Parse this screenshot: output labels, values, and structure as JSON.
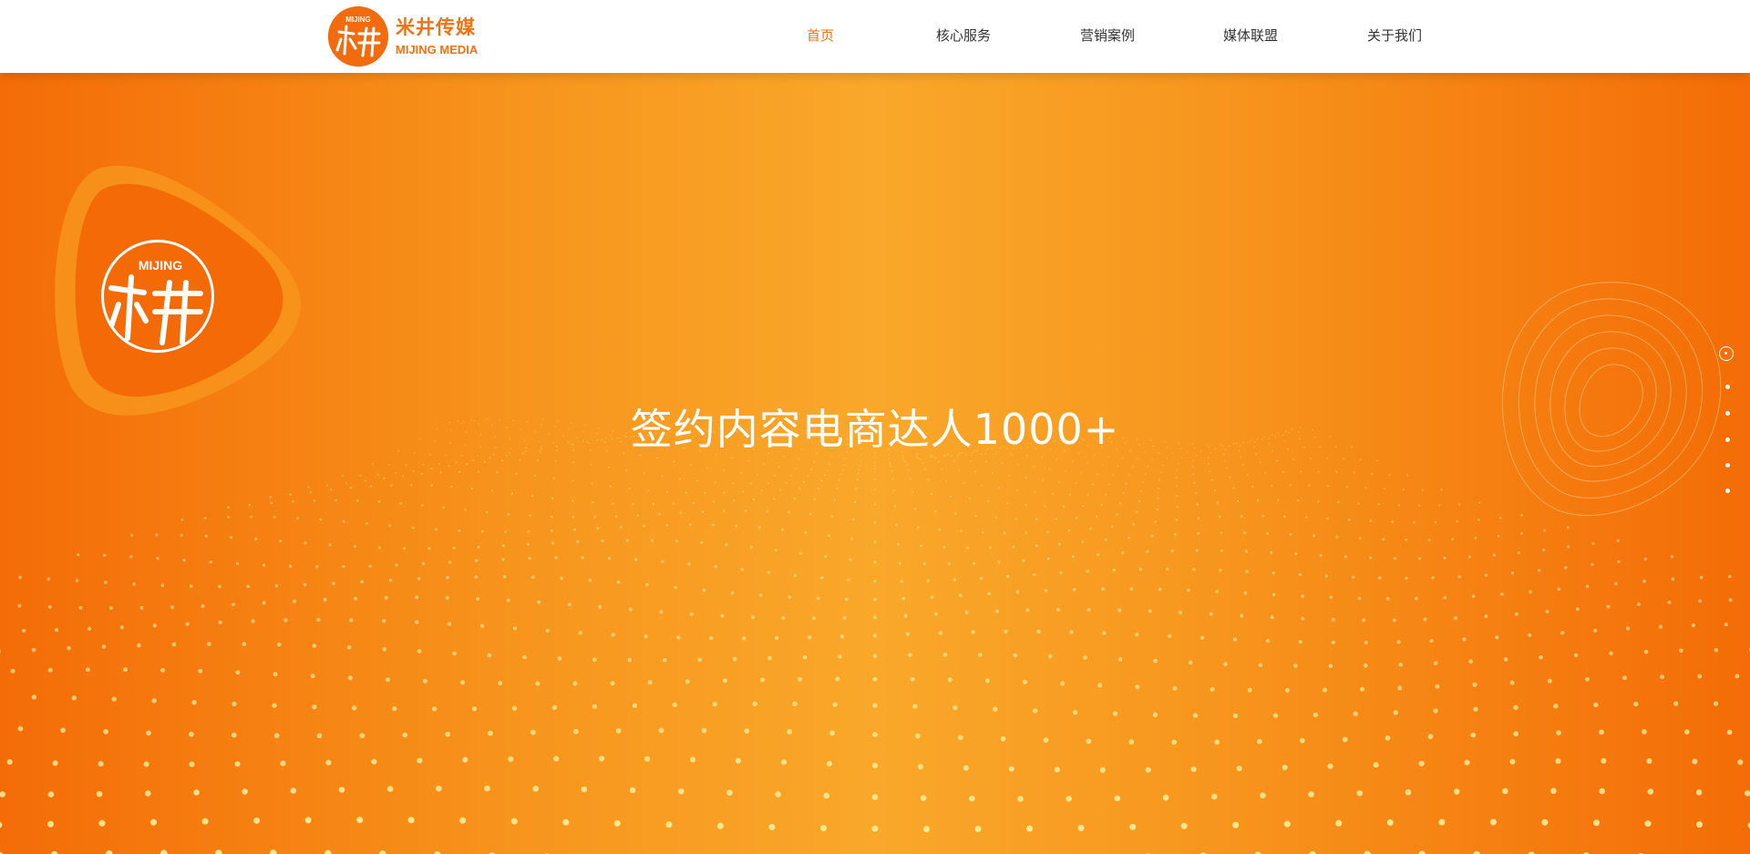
{
  "header": {
    "brand": {
      "name_cn": "米井传媒",
      "name_en": "MIJING MEDIA",
      "mark_text": "MIJING"
    },
    "nav": {
      "items": [
        {
          "label": "首页",
          "active": true
        },
        {
          "label": "核心服务",
          "active": false
        },
        {
          "label": "营销案例",
          "active": false
        },
        {
          "label": "媒体联盟",
          "active": false
        },
        {
          "label": "关于我们",
          "active": false
        }
      ]
    }
  },
  "hero": {
    "title": "签约内容电商达人1000+",
    "logo_text": "MIJING",
    "slider": {
      "count": 6,
      "active_index": 0
    }
  },
  "colors": {
    "brand_orange": "#f27213",
    "hero_edge": "#f46c07",
    "hero_center": "#f9a82a",
    "dot_color": "#fff3a0",
    "text_white": "#ffffff"
  }
}
